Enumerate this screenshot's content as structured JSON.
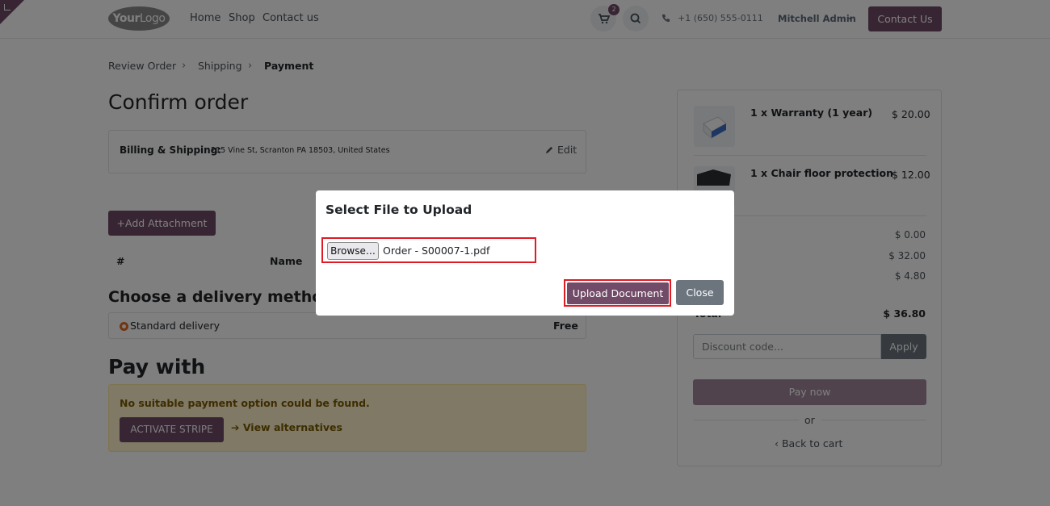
{
  "header": {
    "logo_main": "Your",
    "logo_rest": "Logo",
    "nav": [
      "Home",
      "Shop",
      "Contact us"
    ],
    "cart_count": "2",
    "phone": "+1 (650) 555-0111",
    "user": "Mitchell Admin",
    "contact_button": "Contact Us"
  },
  "breadcrumb": {
    "items": [
      "Review Order",
      "Shipping",
      "Payment"
    ],
    "separator": "›"
  },
  "page": {
    "title": "Confirm order",
    "billing_label": "Billing & Shipping:",
    "billing_address": "215 Vine St, Scranton PA 18503, United States",
    "edit_label": "Edit",
    "add_attachment": "+Add Attachment",
    "table_headers": [
      "#",
      "Name"
    ],
    "delivery_title": "Choose a delivery method",
    "delivery_method": "Standard delivery",
    "delivery_price": "Free",
    "pay_title": "Pay with",
    "payment_warning": "No suitable payment option could be found.",
    "activate_stripe": "ACTIVATE STRIPE",
    "view_alternatives": "➔ View alternatives"
  },
  "summary": {
    "items": [
      {
        "name": "1 x Warranty (1 year)",
        "price": "$ 20.00"
      },
      {
        "name": "1 x Chair floor protection",
        "price": "$ 12.00"
      }
    ],
    "values": [
      "$ 0.00",
      "$ 32.00",
      "$ 4.80"
    ],
    "total_label": "Total",
    "total": "$ 36.80",
    "discount_placeholder": "Discount code...",
    "apply_label": "Apply",
    "pay_now": "Pay now",
    "or_label": "or",
    "back_to_cart": "‹  Back to cart"
  },
  "modal": {
    "title": "Select File to Upload",
    "browse_label": "Browse…",
    "file_name": "Order - S00007-1.pdf",
    "upload_label": "Upload Document",
    "close_label": "Close"
  },
  "colors": {
    "brand": "#714b67",
    "highlight": "#e01b24",
    "secondary": "#6c757d"
  }
}
